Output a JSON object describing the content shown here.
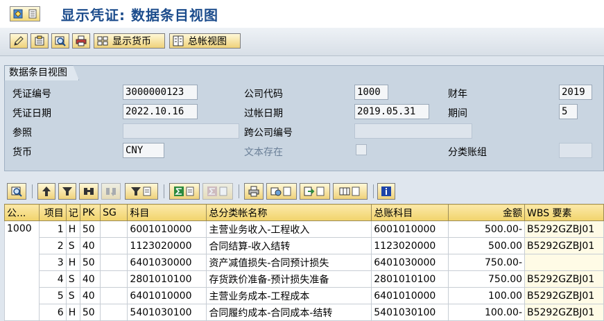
{
  "window": {
    "title": "显示凭证: 数据条目视图"
  },
  "toolbar": {
    "show_currency_label": "显示货币",
    "gl_view_label": "总帐视图"
  },
  "panel": {
    "tab_label": "数据条目视图",
    "doc_number_label": "凭证编号",
    "doc_number_value": "3000000123",
    "company_code_label": "公司代码",
    "company_code_value": "1000",
    "fiscal_year_label": "财年",
    "fiscal_year_value": "2019",
    "doc_date_label": "凭证日期",
    "doc_date_value": "2022.10.16",
    "posting_date_label": "过帐日期",
    "posting_date_value": "2019.05.31",
    "period_label": "期间",
    "period_value": "5",
    "reference_label": "参照",
    "cross_company_label": "跨公司编号",
    "currency_label": "货币",
    "currency_value": "CNY",
    "text_exists_label": "文本存在",
    "ledger_group_label": "分类账组"
  },
  "table": {
    "headers": {
      "company": "公...",
      "item": "项目",
      "dc": "记",
      "pk": "PK",
      "sg": "SG",
      "account": "科目",
      "account_name": "总分类帐名称",
      "gl_account": "总账科目",
      "amount": "金额",
      "wbs": "WBS 要素"
    },
    "company_value": "1000",
    "rows": [
      {
        "item": "1",
        "dc": "H",
        "pk": "50",
        "sg": "",
        "account": "6001010000",
        "name": "主营业务收入-工程收入",
        "gl": "6001010000",
        "amount": "500.00-",
        "wbs": "B5292GZBJ01"
      },
      {
        "item": "2",
        "dc": "S",
        "pk": "40",
        "sg": "",
        "account": "1123020000",
        "name": "合同结算-收入结转",
        "gl": "1123020000",
        "amount": "500.00",
        "wbs": "B5292GZBJ01"
      },
      {
        "item": "3",
        "dc": "H",
        "pk": "50",
        "sg": "",
        "account": "6401030000",
        "name": "资产减值损失-合同预计损失",
        "gl": "6401030000",
        "amount": "750.00-",
        "wbs": ""
      },
      {
        "item": "4",
        "dc": "S",
        "pk": "40",
        "sg": "",
        "account": "2801010100",
        "name": "存货跌价准备-预计损失准备",
        "gl": "2801010100",
        "amount": "750.00",
        "wbs": "B5292GZBJ01"
      },
      {
        "item": "5",
        "dc": "S",
        "pk": "40",
        "sg": "",
        "account": "6401010000",
        "name": "主营业务成本-工程成本",
        "gl": "6401010000",
        "amount": "100.00",
        "wbs": "B5292GZBJ01"
      },
      {
        "item": "6",
        "dc": "H",
        "pk": "50",
        "sg": "",
        "account": "5401030100",
        "name": "合同履约成本-合同成本-结转",
        "gl": "5401030100",
        "amount": "100.00-",
        "wbs": "B5292GZBJ01"
      }
    ]
  },
  "icons": {
    "toolbar": [
      "pencil-icon",
      "display-change-icon",
      "overview-icon",
      "printer-icon",
      "currency-icon",
      "gl-view-icon"
    ],
    "grid": [
      "details-icon",
      "sort-asc-icon",
      "filter-icon",
      "find-icon",
      "find-next-icon",
      "set-filter-icon",
      "sum-icon",
      "subtotal-icon",
      "print-icon",
      "change-layout-icon",
      "export-icon",
      "select-layout-icon",
      "info-icon"
    ]
  }
}
